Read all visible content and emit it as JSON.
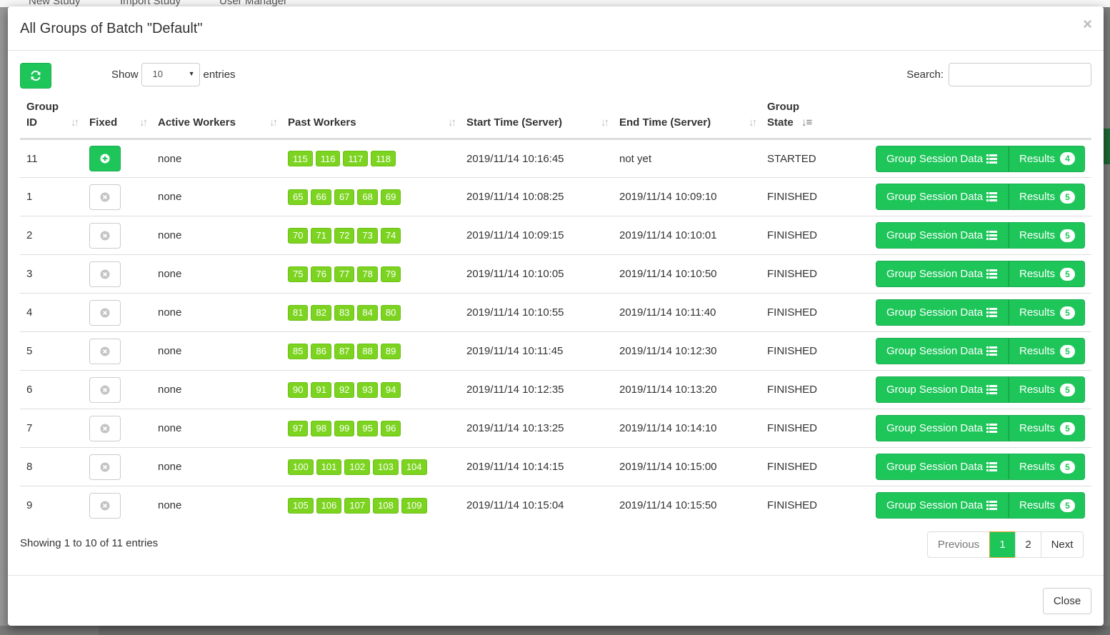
{
  "background": {
    "topbar": [
      "New Study",
      "Import Study",
      "User Manager"
    ]
  },
  "modal": {
    "title": "All Groups of Batch \"Default\"",
    "close_x": "×",
    "close_button": "Close"
  },
  "controls": {
    "show_label": "Show",
    "entries_label": "entries",
    "length_value": "10",
    "search_label": "Search:",
    "search_value": ""
  },
  "table": {
    "headers": {
      "group_id": [
        "Group",
        "ID"
      ],
      "fixed": "Fixed",
      "active_workers": "Active Workers",
      "past_workers": "Past Workers",
      "start_time": "Start Time (Server)",
      "end_time": "End Time (Server)",
      "group_state": [
        "Group",
        "State"
      ]
    },
    "gsd_label": "Group Session Data",
    "results_label": "Results",
    "rows": [
      {
        "id": "11",
        "fixed": true,
        "active": "none",
        "past": [
          "115",
          "116",
          "117",
          "118"
        ],
        "start": "2019/11/14 10:16:45",
        "end": "not yet",
        "state": "STARTED",
        "results": "4"
      },
      {
        "id": "1",
        "fixed": false,
        "active": "none",
        "past": [
          "65",
          "66",
          "67",
          "68",
          "69"
        ],
        "start": "2019/11/14 10:08:25",
        "end": "2019/11/14 10:09:10",
        "state": "FINISHED",
        "results": "5"
      },
      {
        "id": "2",
        "fixed": false,
        "active": "none",
        "past": [
          "70",
          "71",
          "72",
          "73",
          "74"
        ],
        "start": "2019/11/14 10:09:15",
        "end": "2019/11/14 10:10:01",
        "state": "FINISHED",
        "results": "5"
      },
      {
        "id": "3",
        "fixed": false,
        "active": "none",
        "past": [
          "75",
          "76",
          "77",
          "78",
          "79"
        ],
        "start": "2019/11/14 10:10:05",
        "end": "2019/11/14 10:10:50",
        "state": "FINISHED",
        "results": "5"
      },
      {
        "id": "4",
        "fixed": false,
        "active": "none",
        "past": [
          "81",
          "82",
          "83",
          "84",
          "80"
        ],
        "start": "2019/11/14 10:10:55",
        "end": "2019/11/14 10:11:40",
        "state": "FINISHED",
        "results": "5"
      },
      {
        "id": "5",
        "fixed": false,
        "active": "none",
        "past": [
          "85",
          "86",
          "87",
          "88",
          "89"
        ],
        "start": "2019/11/14 10:11:45",
        "end": "2019/11/14 10:12:30",
        "state": "FINISHED",
        "results": "5"
      },
      {
        "id": "6",
        "fixed": false,
        "active": "none",
        "past": [
          "90",
          "91",
          "92",
          "93",
          "94"
        ],
        "start": "2019/11/14 10:12:35",
        "end": "2019/11/14 10:13:20",
        "state": "FINISHED",
        "results": "5"
      },
      {
        "id": "7",
        "fixed": false,
        "active": "none",
        "past": [
          "97",
          "98",
          "99",
          "95",
          "96"
        ],
        "start": "2019/11/14 10:13:25",
        "end": "2019/11/14 10:14:10",
        "state": "FINISHED",
        "results": "5"
      },
      {
        "id": "8",
        "fixed": false,
        "active": "none",
        "past": [
          "100",
          "101",
          "102",
          "103",
          "104"
        ],
        "start": "2019/11/14 10:14:15",
        "end": "2019/11/14 10:15:00",
        "state": "FINISHED",
        "results": "5"
      },
      {
        "id": "9",
        "fixed": false,
        "active": "none",
        "past": [
          "105",
          "106",
          "107",
          "108",
          "109"
        ],
        "start": "2019/11/14 10:15:04",
        "end": "2019/11/14 10:15:50",
        "state": "FINISHED",
        "results": "5"
      }
    ]
  },
  "footer": {
    "info": "Showing 1 to 10 of 11 entries",
    "pagination": {
      "previous": "Previous",
      "pages": [
        "1",
        "2"
      ],
      "next": "Next"
    }
  },
  "colors": {
    "accent_green": "#1ec65a",
    "badge_green": "#7cd420"
  }
}
